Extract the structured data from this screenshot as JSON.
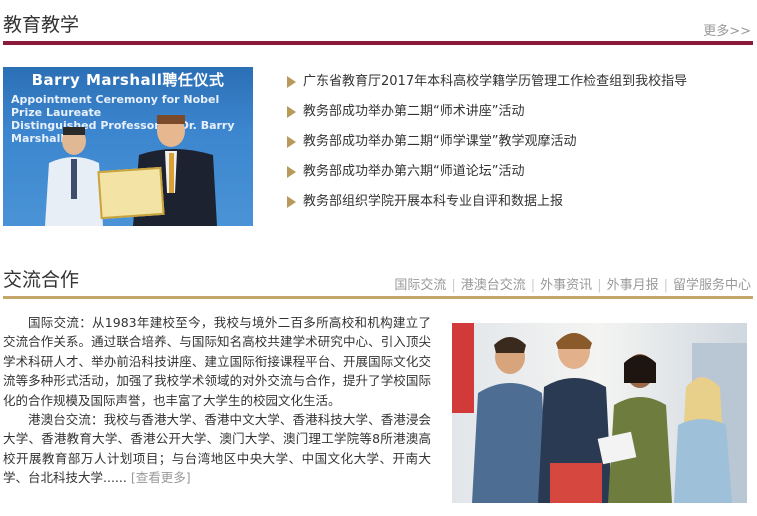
{
  "education": {
    "title": "教育教学",
    "more": "更多>>",
    "photo": {
      "banner": "Barry Marshall聘任仪式",
      "subtitle_line1": "Appointment Ceremony for Nobel Prize Laureate",
      "subtitle_line2": "Distinguished Professor of Dr. Barry Marshall"
    },
    "news": [
      "广东省教育厅2017年本科高校学籍学历管理工作检查组到我校指导",
      "教务部成功举办第二期“师术讲座”活动",
      "教务部成功举办第二期“师学课堂”教学观摩活动",
      "教务部成功举办第六期“师道论坛”活动",
      "教务部组织学院开展本科专业自评和数据上报"
    ]
  },
  "exchange": {
    "title": "交流合作",
    "tabs": [
      "国际交流",
      "港澳台交流",
      "外事资讯",
      "外事月报",
      "留学服务中心"
    ],
    "paragraph1": "国际交流：从1983年建校至今，我校与境外二百多所高校和机构建立了交流合作关系。通过联合培养、与国际知名高校共建学术研究中心、引入顶尖学术科研人才、举办前沿科技讲座、建立国际衔接课程平台、开展国际文化交流等多种形式活动，加强了我校学术领域的对外交流与合作，提升了学校国际化的合作规模及国际声誉，也丰富了大学生的校园文化生活。",
    "paragraph2": "港澳台交流：我校与香港大学、香港中文大学、香港科技大学、香港浸会大学、香港教育大学、香港公开大学、澳门大学、澳门理工学院等8所港澳高校开展教育部万人计划项目；与台湾地区中央大学、中国文化大学、开南大学、台北科技大学......",
    "more": "[查看更多]"
  },
  "colors": {
    "primary_bar": "#8b1a3a",
    "secondary_bar": "#c6a76a",
    "bullet": "#b89a5a"
  }
}
